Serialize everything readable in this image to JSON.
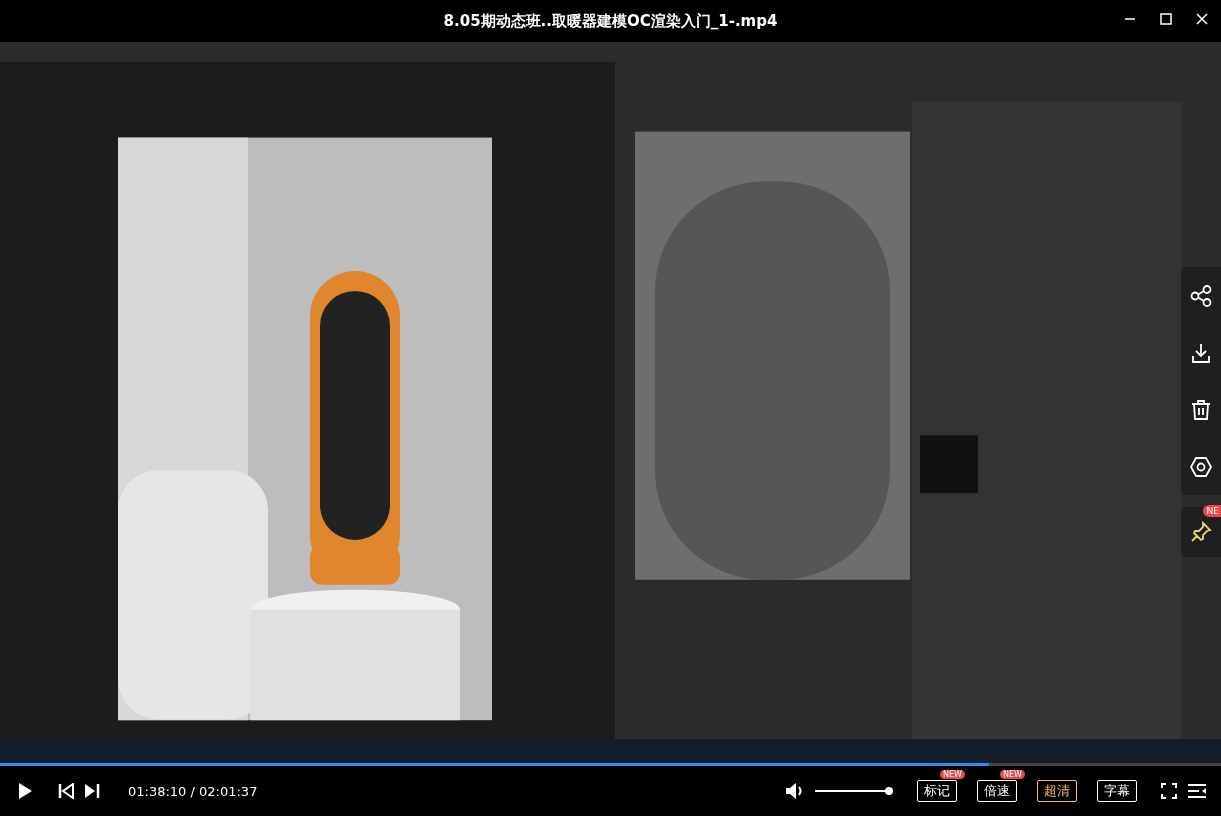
{
  "window": {
    "title": "8.05期动态班..取暖器建模OC渲染入门_1-.mp4"
  },
  "side_panel": {
    "pin_badge": "NE"
  },
  "progress": {
    "level": 0.81
  },
  "controls": {
    "time": "01:38:10 / 02:01:37",
    "volume": {
      "level": 0.97
    },
    "buttons": [
      {
        "label": "标记",
        "badge": "NEW",
        "selected": false
      },
      {
        "label": "倍速",
        "badge": "NEW",
        "selected": false
      },
      {
        "label": "超清",
        "selected": true
      },
      {
        "label": "字幕",
        "selected": false
      }
    ]
  }
}
